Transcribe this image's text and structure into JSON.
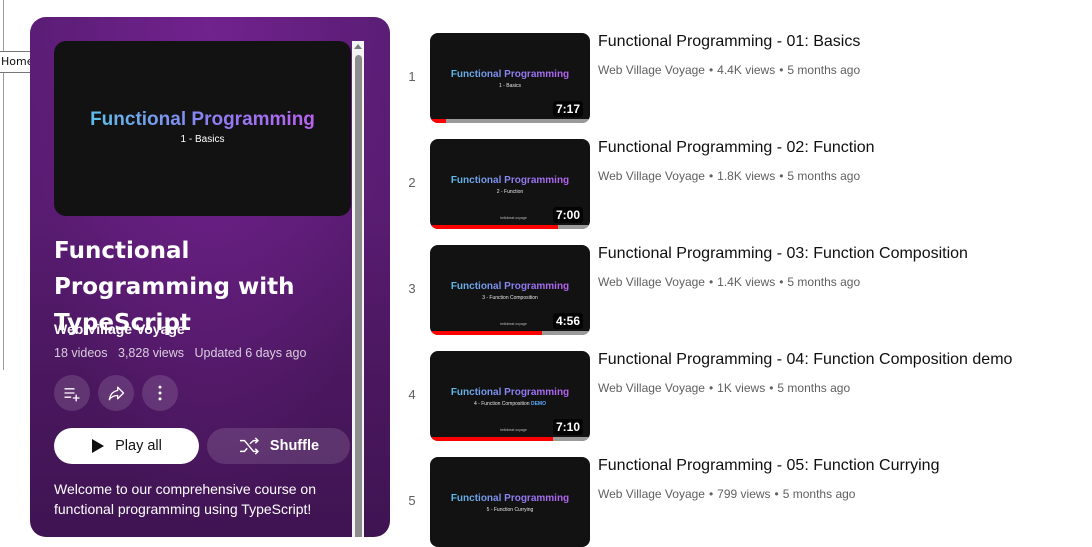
{
  "tooltip": "Home",
  "playlist": {
    "thumb_title": "Functional Programming",
    "thumb_sub": "1 - Basics",
    "title": "Functional Programming with TypeScript",
    "channel": "Web Village Voyage",
    "videos": "18 videos",
    "views": "3,828 views",
    "updated": "Updated 6 days ago",
    "play_all_label": "Play all",
    "shuffle_label": "Shuffle",
    "description": "Welcome to our comprehensive course on functional programming using TypeScript!",
    "icons": [
      "save-to-playlist-icon",
      "share-icon",
      "more-options-icon",
      "play-icon",
      "shuffle-icon"
    ]
  },
  "videos": [
    {
      "index": "1",
      "title": "Functional Programming - 01: Basics",
      "channel": "Web Village Voyage",
      "views": "4.4K views",
      "age": "5 months ago",
      "duration": "7:17",
      "thumb_title": "Functional Programming",
      "thumb_sub": "1 - Basics",
      "thumb_sub_accent": "",
      "watermark": "",
      "progress": 0.1
    },
    {
      "index": "2",
      "title": "Functional Programming - 02: Function",
      "channel": "Web Village Voyage",
      "views": "1.8K views",
      "age": "5 months ago",
      "duration": "7:00",
      "thumb_title": "Functional Programming",
      "thumb_sub": "2 - Function",
      "thumb_sub_accent": "",
      "watermark": "hellobeat-voyage",
      "progress": 0.8
    },
    {
      "index": "3",
      "title": "Functional Programming - 03: Function Composition",
      "channel": "Web Village Voyage",
      "views": "1.4K views",
      "age": "5 months ago",
      "duration": "4:56",
      "thumb_title": "Functional Programming",
      "thumb_sub": "3 - Function Composition",
      "thumb_sub_accent": "",
      "watermark": "hellobeat-voyage",
      "progress": 0.7
    },
    {
      "index": "4",
      "title": "Functional Programming - 04: Function Composition demo",
      "channel": "Web Village Voyage",
      "views": "1K views",
      "age": "5 months ago",
      "duration": "7:10",
      "thumb_title": "Functional Programming",
      "thumb_sub": "4 - Function Composition",
      "thumb_sub_accent": "DEMO",
      "watermark": "hellobeat-voyage",
      "progress": 0.77
    },
    {
      "index": "5",
      "title": "Functional Programming - 05: Function Currying",
      "channel": "Web Village Voyage",
      "views": "799 views",
      "age": "5 months ago",
      "duration": "",
      "thumb_title": "Functional Programming",
      "thumb_sub": "5 - Function Currying",
      "thumb_sub_accent": "",
      "watermark": "",
      "progress": 0
    }
  ],
  "colors": {
    "header_gradient_top": "#5b1d76",
    "header_gradient_bottom": "#3f1452",
    "progress_red": "#ff0000",
    "meta_gray": "#606060"
  }
}
